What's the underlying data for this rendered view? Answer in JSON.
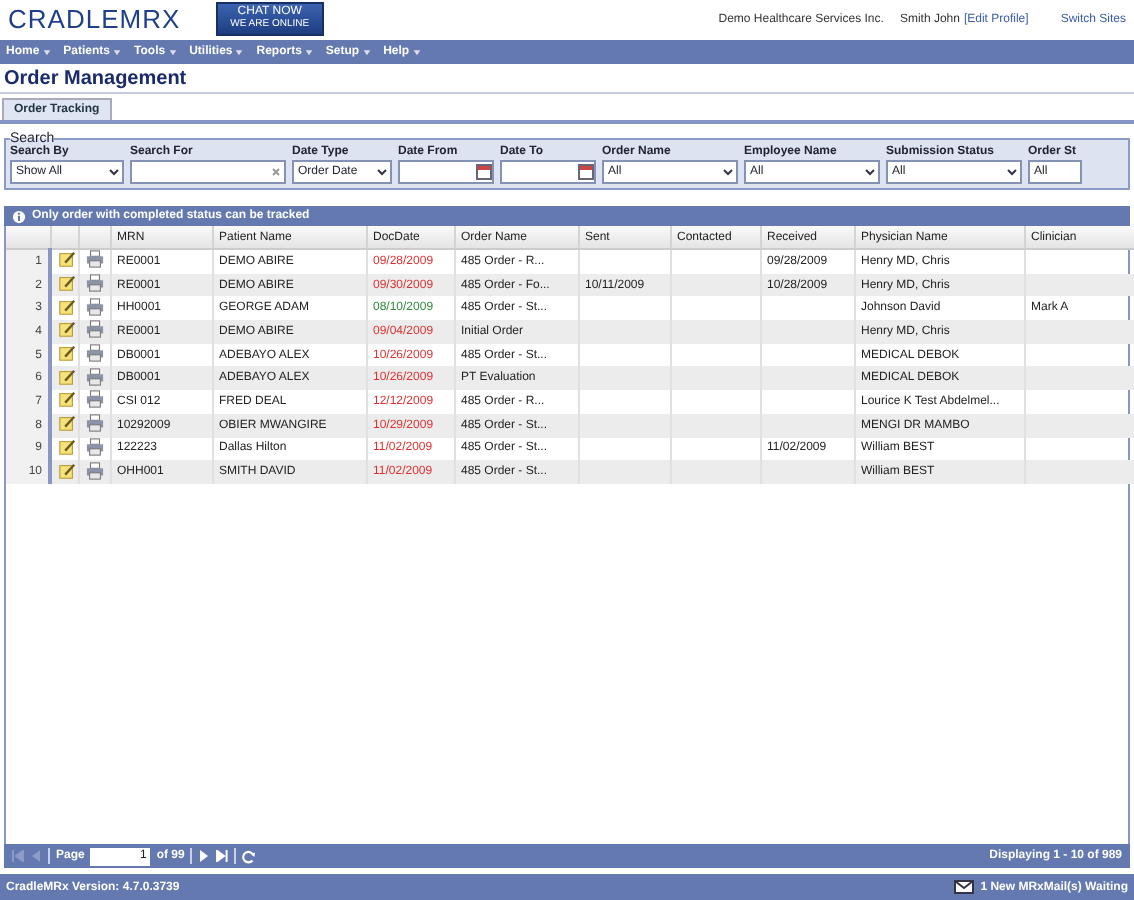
{
  "header": {
    "logo": "CRADLEMRX",
    "chat_button": {
      "title": "CHAT NOW",
      "subtitle": "WE ARE ONLINE"
    },
    "company": "Demo Healthcare Services Inc.",
    "user": "Smith John",
    "edit_profile": "[Edit Profile]",
    "switch_sites": "Switch Sites"
  },
  "menu": [
    "Home",
    "Patients",
    "Tools",
    "Utilities",
    "Reports",
    "Setup",
    "Help"
  ],
  "page_title": "Order Management",
  "tabs": [
    {
      "label": "Order Tracking",
      "selected": true
    }
  ],
  "search": {
    "legend": "Search",
    "fields": [
      {
        "kind": "select",
        "label": "Search By",
        "value": "Show All"
      },
      {
        "kind": "text",
        "label": "Search For"
      },
      {
        "kind": "select",
        "label": "Date Type",
        "value": "Order Date"
      },
      {
        "kind": "date",
        "label": "Date From"
      },
      {
        "kind": "date",
        "label": "Date To"
      },
      {
        "kind": "select",
        "label": "Order Name",
        "value": "All"
      },
      {
        "kind": "select",
        "label": "Employee Name",
        "value": "All"
      },
      {
        "kind": "select",
        "label": "Submission Status",
        "value": "All"
      },
      {
        "kind": "cut",
        "label": "Order St",
        "value": "All"
      }
    ]
  },
  "info": "Only order with completed status can be tracked",
  "table": {
    "columns": [
      "MRN",
      "Patient Name",
      "DocDate",
      "Order Name",
      "Sent",
      "Contacted",
      "Received",
      "Physician Name",
      "Clinician"
    ],
    "rows": [
      {
        "num": "1",
        "mrn": "RE0001",
        "patient": "DEMO ABIRE",
        "doc_date": "09/28/2009",
        "color": "#e03030",
        "order": "485 Order - R...",
        "sent": "",
        "contacted": "",
        "received": "09/28/2009",
        "physician": "Henry MD, Chris",
        "clinician": ""
      },
      {
        "num": "2",
        "mrn": "RE0001",
        "patient": "DEMO ABIRE",
        "doc_date": "09/30/2009",
        "color": "#e03030",
        "order": "485 Order - Fo...",
        "sent": "10/11/2009",
        "contacted": "",
        "received": "10/28/2009",
        "physician": "Henry MD, Chris",
        "clinician": ""
      },
      {
        "num": "3",
        "mrn": "HH0001",
        "patient": "GEORGE ADAM",
        "doc_date": "08/10/2009",
        "color": "#2f8a3a",
        "order": "485 Order - St...",
        "sent": "",
        "contacted": "",
        "received": "",
        "physician": "Johnson David",
        "clinician": "Mark A"
      },
      {
        "num": "4",
        "mrn": "RE0001",
        "patient": "DEMO ABIRE",
        "doc_date": "09/04/2009",
        "color": "#e03030",
        "order": "Initial Order",
        "sent": "",
        "contacted": "",
        "received": "",
        "physician": "Henry MD, Chris",
        "clinician": ""
      },
      {
        "num": "5",
        "mrn": "DB0001",
        "patient": "ADEBAYO ALEX",
        "doc_date": "10/26/2009",
        "color": "#e03030",
        "order": "485 Order - St...",
        "sent": "",
        "contacted": "",
        "received": "",
        "physician": "MEDICAL DEBOK",
        "clinician": ""
      },
      {
        "num": "6",
        "mrn": "DB0001",
        "patient": "ADEBAYO ALEX",
        "doc_date": "10/26/2009",
        "color": "#e03030",
        "order": "PT Evaluation",
        "sent": "",
        "contacted": "",
        "received": "",
        "physician": "MEDICAL DEBOK",
        "clinician": ""
      },
      {
        "num": "7",
        "mrn": "CSI 012",
        "patient": "FRED DEAL",
        "doc_date": "12/12/2009",
        "color": "#e03030",
        "order": "485 Order - R...",
        "sent": "",
        "contacted": "",
        "received": "",
        "physician": "Lourice K Test Abdelmel...",
        "clinician": ""
      },
      {
        "num": "8",
        "mrn": "10292009",
        "patient": "OBIER MWANGIRE",
        "doc_date": "10/29/2009",
        "color": "#e03030",
        "order": "485 Order - St...",
        "sent": "",
        "contacted": "",
        "received": "",
        "physician": "MENGI DR MAMBO",
        "clinician": ""
      },
      {
        "num": "9",
        "mrn": "122223",
        "patient": "Dallas Hilton",
        "doc_date": "11/02/2009",
        "color": "#e03030",
        "order": "485 Order - St...",
        "sent": "",
        "contacted": "",
        "received": "11/02/2009",
        "physician": "William BEST",
        "clinician": ""
      },
      {
        "num": "10",
        "mrn": "OHH001",
        "patient": "SMITH DAVID",
        "doc_date": "11/02/2009",
        "color": "#e03030",
        "order": "485 Order - St...",
        "sent": "",
        "contacted": "",
        "received": "",
        "physician": "William BEST",
        "clinician": ""
      }
    ]
  },
  "pager": {
    "page_label": "Page",
    "page": "1",
    "of": "of 99",
    "displaying": "Displaying 1 - 10 of 989"
  },
  "footer": {
    "version": "CradleMRx Version: 4.7.0.3739",
    "mail": "1 New MRxMail(s) Waiting"
  }
}
